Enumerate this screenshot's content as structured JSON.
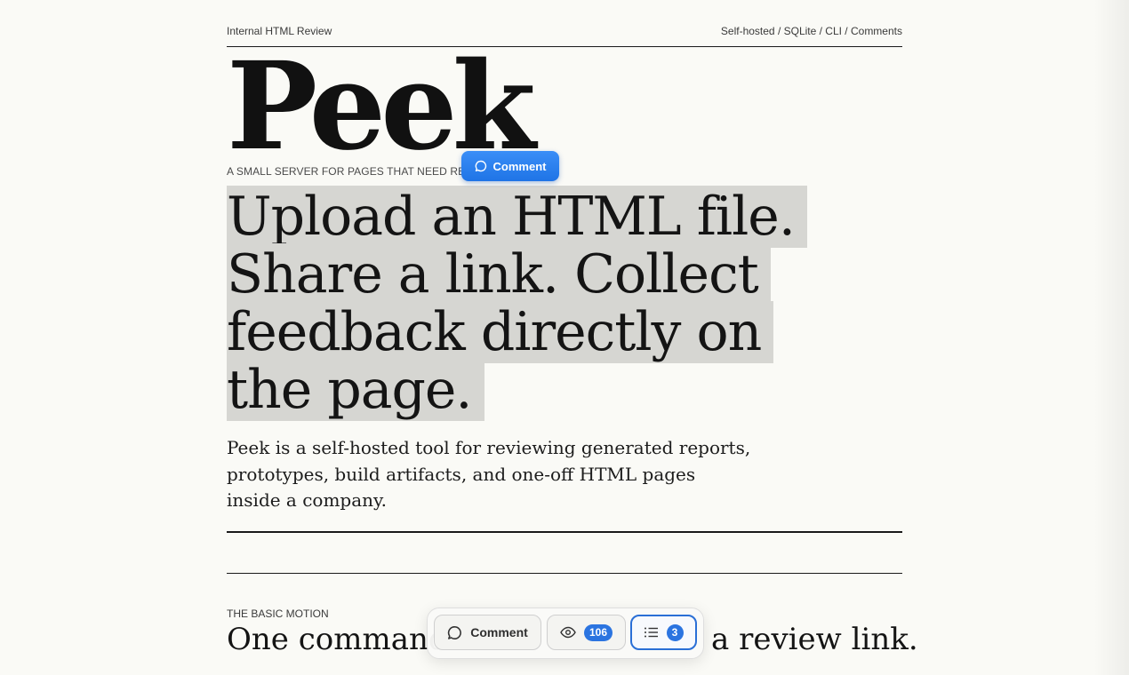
{
  "header": {
    "left": "Internal HTML Review",
    "right": "Self-hosted / SQLite / CLI / Comments"
  },
  "hero": {
    "logo": "Peek",
    "tagline": "A SMALL SERVER FOR PAGES THAT NEED RE",
    "headline_lines": [
      "Upload an HTML file.",
      "Share a link. Collect",
      "feedback directly on",
      "the page."
    ],
    "lede": "Peek is a self-hosted tool for reviewing generated reports, prototypes, build artifacts, and one-off HTML pages inside a company."
  },
  "section": {
    "eyebrow": "THE BASIC MOTION",
    "heading_start": "One command",
    "heading_end": "a review link."
  },
  "selection_popover": {
    "label": "Comment",
    "icon": "comment-bubble-icon"
  },
  "toolbar": {
    "comment_label": "Comment",
    "comment_icon": "comment-bubble-icon",
    "views_icon": "eye-icon",
    "views_count": "106",
    "list_icon": "list-icon",
    "list_count": "3"
  },
  "colors": {
    "accent": "#1f74e6",
    "highlight": "#d6d6d2",
    "background": "#fafaf6",
    "text": "#151515"
  }
}
